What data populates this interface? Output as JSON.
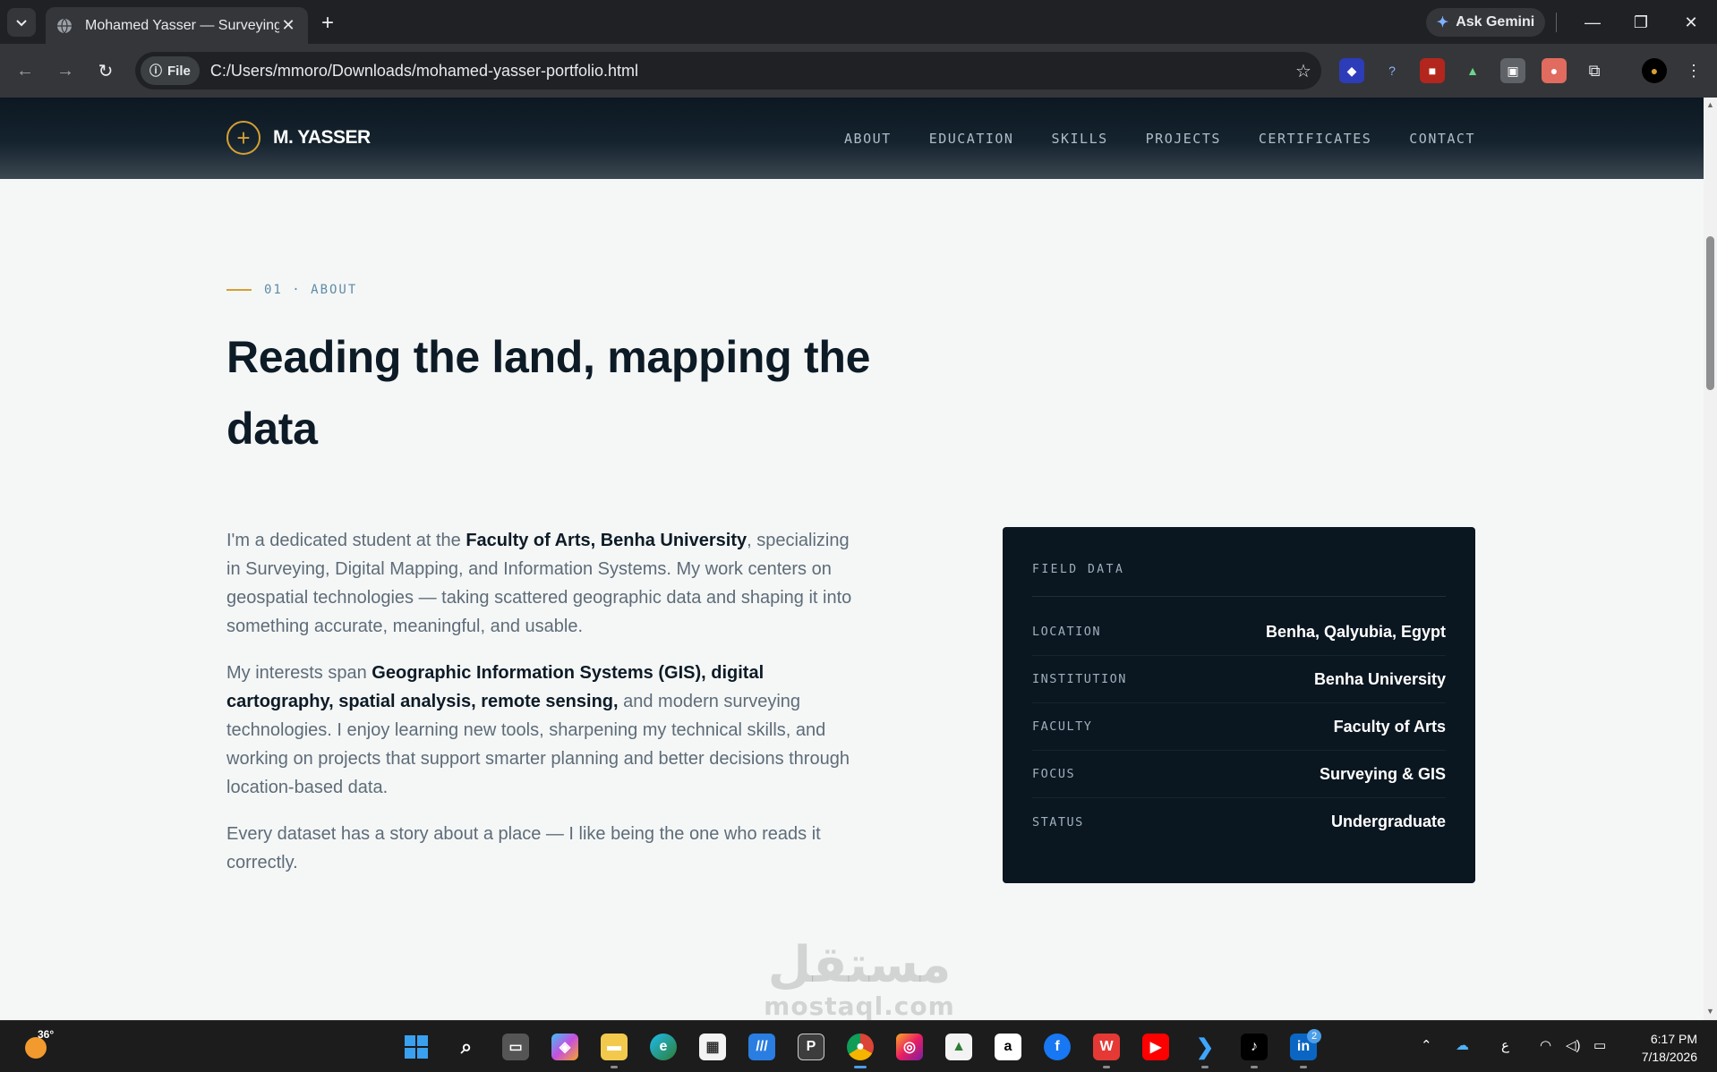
{
  "browser": {
    "tab_title": "Mohamed Yasser — Surveying",
    "new_tab_symbol": "+",
    "ask_gemini": "Ask Gemini",
    "address_chip": "File",
    "url": "C:/Users/mmoro/Downloads/mohamed-yasser-portfolio.html"
  },
  "site": {
    "brand": "M. YASSER",
    "nav": [
      "ABOUT",
      "EDUCATION",
      "SKILLS",
      "PROJECTS",
      "CERTIFICATES",
      "CONTACT"
    ]
  },
  "about": {
    "section_tag": "01 · ABOUT",
    "heading_line1": "Reading the land, mapping the",
    "heading_line2": "data",
    "p1_pre": "I'm a dedicated student at the ",
    "p1_bold": "Faculty of Arts, Benha University",
    "p1_post": ", specializing in Surveying, Digital Mapping, and Information Systems. My work centers on geospatial technologies — taking scattered geographic data and shaping it into something accurate, meaningful, and usable.",
    "p2_pre": "My interests span ",
    "p2_bold": "Geographic Information Systems (GIS), digital cartography, spatial analysis, remote sensing,",
    "p2_post": " and modern surveying technologies. I enjoy learning new tools, sharpening my technical skills, and working on projects that support smarter planning and better decisions through location-based data.",
    "p3": "Every dataset has a story about a place — I like being the one who reads it correctly."
  },
  "field_data": {
    "title": "FIELD DATA",
    "rows": [
      {
        "key": "LOCATION",
        "value": "Benha, Qalyubia, Egypt"
      },
      {
        "key": "INSTITUTION",
        "value": "Benha University"
      },
      {
        "key": "FACULTY",
        "value": "Faculty of Arts"
      },
      {
        "key": "FOCUS",
        "value": "Surveying & GIS"
      },
      {
        "key": "STATUS",
        "value": "Undergraduate"
      }
    ]
  },
  "watermark": {
    "arabic": "مستقل",
    "latin": "mostaql.com"
  },
  "taskbar": {
    "weather_temp": "36°",
    "li_badge": "2",
    "ime": "ع",
    "time": "6:17 PM",
    "date": "7/18/2026"
  }
}
